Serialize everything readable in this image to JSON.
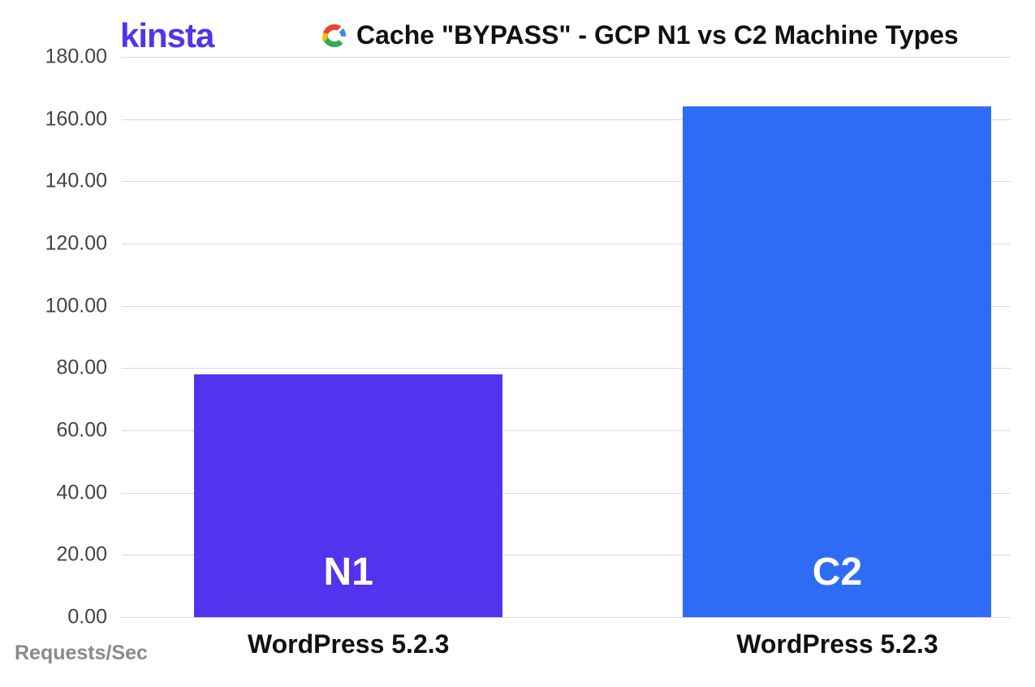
{
  "brand": {
    "logo_text": "kinsta"
  },
  "header": {
    "title": "Cache \"BYPASS\" - GCP N1 vs C2 Machine Types"
  },
  "axis": {
    "ylabel": "Requests/Sec"
  },
  "chart_data": {
    "type": "bar",
    "title": "Cache \"BYPASS\" - GCP N1 vs C2 Machine Types",
    "xlabel": "",
    "ylabel": "Requests/Sec",
    "ylim": [
      0,
      180
    ],
    "yticks": [
      0,
      20,
      40,
      60,
      80,
      100,
      120,
      140,
      160,
      180
    ],
    "ytick_labels": [
      "0.00",
      "20.00",
      "40.00",
      "60.00",
      "80.00",
      "100.00",
      "120.00",
      "140.00",
      "160.00",
      "180.00"
    ],
    "categories": [
      "WordPress 5.2.3",
      "WordPress 5.2.3"
    ],
    "series": [
      {
        "name": "N1",
        "values": [
          78
        ],
        "color": "#5333ed"
      },
      {
        "name": "C2",
        "values": [
          164
        ],
        "color": "#2f6cf6"
      }
    ],
    "bars": [
      {
        "label": "N1",
        "category": "WordPress 5.2.3",
        "value": 78,
        "color": "#5333ed"
      },
      {
        "label": "C2",
        "category": "WordPress 5.2.3",
        "value": 164,
        "color": "#2f6cf6"
      }
    ]
  }
}
